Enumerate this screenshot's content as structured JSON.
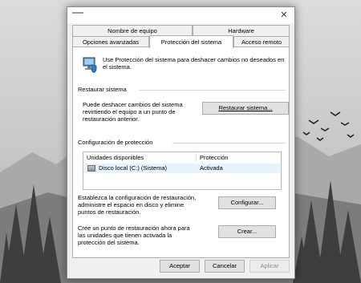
{
  "window": {
    "tabs_top": [
      "Nombre de equipo",
      "Hardware"
    ],
    "tabs_bottom": [
      "Opciones avanzadas",
      "Protección del sistema",
      "Acceso remoto"
    ],
    "close_glyph": "✕"
  },
  "intro": {
    "text": "Use Protección del sistema para deshacer cambios no deseados en el sistema.",
    "icon": "computer-shield-icon"
  },
  "restore": {
    "section_title": "Restaurar sistema",
    "description": "Puede deshacer cambios del sistema revirtiendo el equipo a un punto de restauración anterior.",
    "button_label": "Restaurar sistema..."
  },
  "protection": {
    "section_title": "Configuración de protección",
    "columns": [
      "Unidades disponibles",
      "Protección"
    ],
    "rows": [
      {
        "drive": "Disco local (C:) (Sistema)",
        "status": "Activada",
        "icon": "hard-drive-icon"
      }
    ],
    "configure_text": "Establezca la configuración de restauración, administre el espacio en disco y elimine puntos de restauración.",
    "configure_button": "Configurar...",
    "create_text": "Cree un punto de restauración ahora para las unidades que tienen activada la protección del sistema.",
    "create_button": "Crear..."
  },
  "footer": {
    "ok": "Aceptar",
    "cancel": "Cancelar",
    "apply": "Aplicar"
  },
  "colors": {
    "accent_arrow": "#2b8fd8",
    "selection": "#e5f3ff"
  }
}
